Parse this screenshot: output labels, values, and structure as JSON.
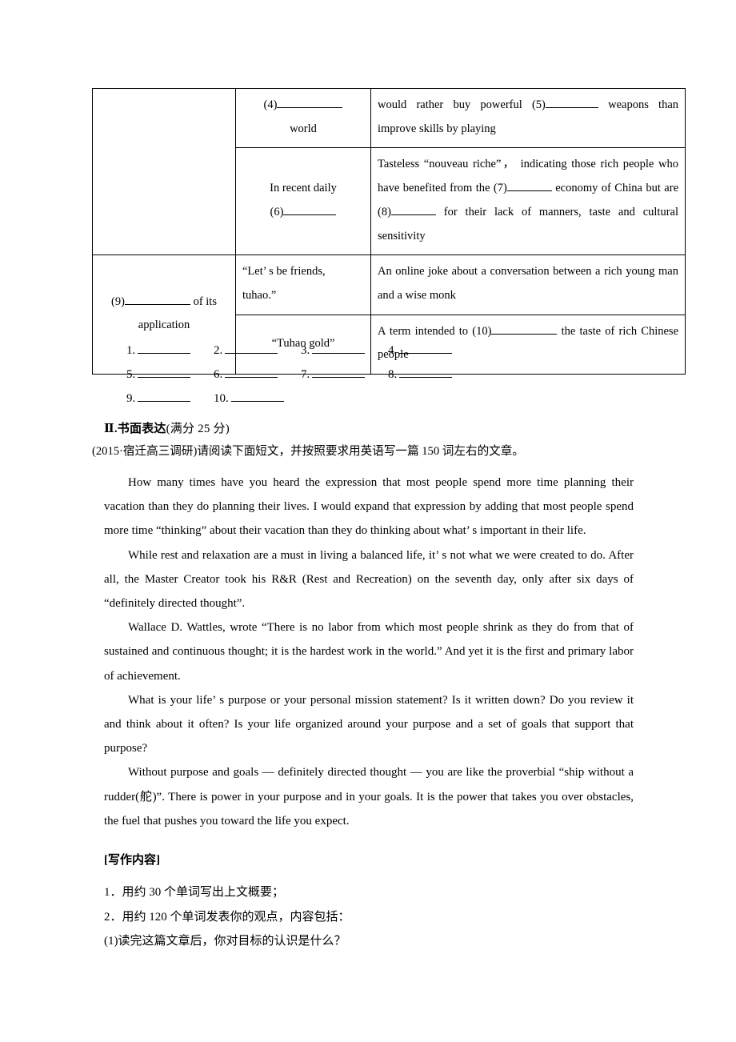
{
  "table": {
    "rows": [
      {
        "col_a": "",
        "col_a_rowspan": 2,
        "cells": [
          {
            "col_b_line1_prefix": "(4)",
            "col_b_line1_blank": true,
            "col_b_line2": "world",
            "col_c": "would rather buy powerful (5)________ weapons than improve skills by playing"
          },
          {
            "col_b_line1": "In recent daily",
            "col_b_line2_prefix": "(6)",
            "col_b_line2_blank": true,
            "col_c": "Tasteless “nouveau riche”，   indicating those rich people who have benefited from the (7)______ economy of China but are (8)______ for their lack of manners, taste and cultural sensitivity"
          }
        ]
      },
      {
        "col_a_line1_prefix": "(9)",
        "col_a_line1_suffix": " of its",
        "col_a_line2": "application",
        "col_a_rowspan": 2,
        "cells": [
          {
            "col_b_line1": "“Let’ s be friends,",
            "col_b_line2": "tuhao.”",
            "col_c": "An online joke about a conversation between a rich young man and   a wise monk"
          },
          {
            "col_b_line1": "“Tuhao gold”",
            "col_c": "A term intended to (10)_________ the taste of rich Chinese people"
          }
        ]
      }
    ],
    "cell_texts": {
      "r1c2_pre": "(4)",
      "r1c2_word": "world",
      "r1c3": "would rather buy powerful (5)",
      "r1c3_tail": " weapons than improve skills by playing",
      "r2c2_line1": "In recent daily",
      "r2c2_pre": "(6)",
      "r2c3_a": "Tasteless “nouveau riche”，   indicating those rich people who have benefited from the (7)",
      "r2c3_b": " economy of China but are (8)",
      "r2c3_c": " for their lack of manners, taste and cultural sensitivity",
      "r3c1_pre": "(9)",
      "r3c1_post": " of its",
      "r3c1_line2": "application",
      "r3c2_line1": "“Let’ s be friends,",
      "r3c2_line2": "tuhao.”",
      "r3c3": "An online joke about a conversation between a rich young man and   a wise monk",
      "r4c2": "“Tuhao gold”",
      "r4c3_a": "A term intended to (10)",
      "r4c3_b": " the taste of rich Chinese people"
    }
  },
  "answer_blanks": {
    "rows": [
      [
        "1.",
        "2.",
        "3.",
        "4."
      ],
      [
        "5.",
        "6.",
        "7.",
        "8."
      ],
      [
        "9.",
        "10."
      ]
    ]
  },
  "section": {
    "heading_bold": "Ⅱ.书面表达",
    "heading_rest": "(满分 25 分)",
    "prompt": "(2015·宿迁高三调研)请阅读下面短文，并按照要求用英语写一篇 150 词左右的文章。"
  },
  "passage": {
    "paragraphs": [
      "How many times have you heard the expression that most people spend more time planning their vacation than they do planning their lives. I would expand that expression by adding that most people spend more time “thinking” about their vacation than they do thinking about what’ s important in their life.",
      "While rest and relaxation are a must in living a balanced life, it’ s not what we were created to do. After all, the Master Creator took his R&R (Rest and Recreation) on the seventh day, only after six days of “definitely directed thought”.",
      "Wallace D. Wattles, wrote “There is no labor from which most people shrink as they do from that of sustained and continuous thought; it is the hardest work in the world.” And yet it is the first and primary labor of achievement.",
      "What is your life’ s purpose or your personal mission statement? Is it written down? Do you review it and think about it often? Is your life organized around your purpose and a set of goals that support that purpose?",
      "Without purpose and goals — definitely directed thought — you are like the proverbial “ship without a rudder(舵)”. There is power in your purpose and in your goals. It is the power that takes you over obstacles, the fuel that pushes you toward the life you expect."
    ]
  },
  "writing_requirements": {
    "heading": "[写作内容]",
    "items": [
      "1．用约 30 个单词写出上文概要；",
      "2．用约 120 个单词发表你的观点，内容包括：",
      "(1)读完这篇文章后，你对目标的认识是什么？"
    ]
  },
  "colors": {
    "text": "#000000",
    "border": "#000000",
    "background": "#ffffff"
  }
}
